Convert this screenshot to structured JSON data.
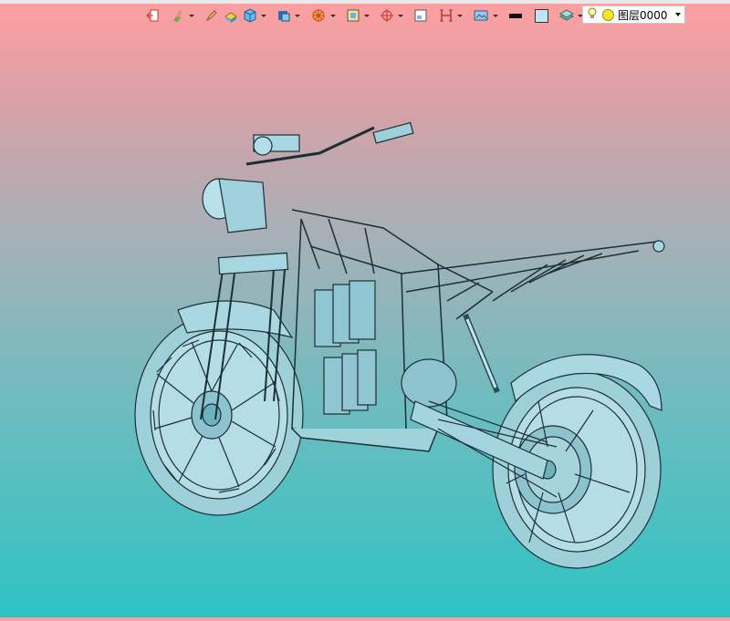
{
  "toolbar": {
    "icons": [
      "exit-icon",
      "brush-icon",
      "pencil-icon",
      "yellow-solid-icon",
      "cube-icon",
      "view-cube-icon",
      "wheel-icon",
      "rectangle-select-icon",
      "crosshair-icon",
      "frame-icon",
      "section-icon",
      "render-mode-icon"
    ],
    "line_color": "#111111",
    "fill_color": "#bfe4f2"
  },
  "layer": {
    "name": "图层0000",
    "visible_icon": "lightbulb-icon",
    "color_icon": "yellow-dot-icon"
  },
  "viewport": {
    "subject": "motorcycle-wireframe-model",
    "background_top": "#ff9fa0",
    "background_bottom": "#2ec3c3",
    "model_color": "#8fc8d4"
  }
}
